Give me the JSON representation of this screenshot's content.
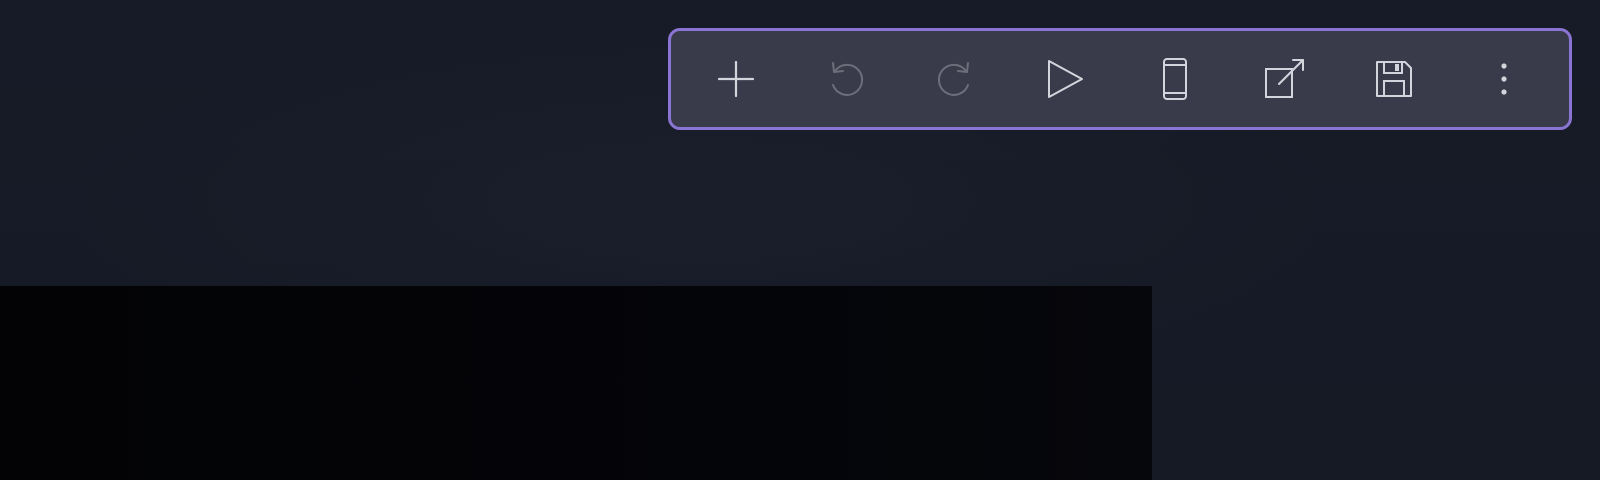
{
  "colors": {
    "background": "#161a26",
    "toolbar_background": "#393b4b",
    "toolbar_border": "#8b75d4",
    "icon_enabled": "#d4d5dc",
    "icon_disabled": "#6c6e7a",
    "preview_background": "#040509"
  },
  "toolbar": {
    "buttons": [
      {
        "id": "add",
        "icon": "plus-icon",
        "enabled": true
      },
      {
        "id": "undo",
        "icon": "undo-icon",
        "enabled": false
      },
      {
        "id": "redo",
        "icon": "redo-icon",
        "enabled": false
      },
      {
        "id": "run",
        "icon": "play-icon",
        "enabled": true
      },
      {
        "id": "device-preview",
        "icon": "phone-icon",
        "enabled": true
      },
      {
        "id": "open-external",
        "icon": "open-external-icon",
        "enabled": true
      },
      {
        "id": "save",
        "icon": "floppy-disk-icon",
        "enabled": true
      },
      {
        "id": "more",
        "icon": "more-vertical-icon",
        "enabled": true
      }
    ]
  }
}
